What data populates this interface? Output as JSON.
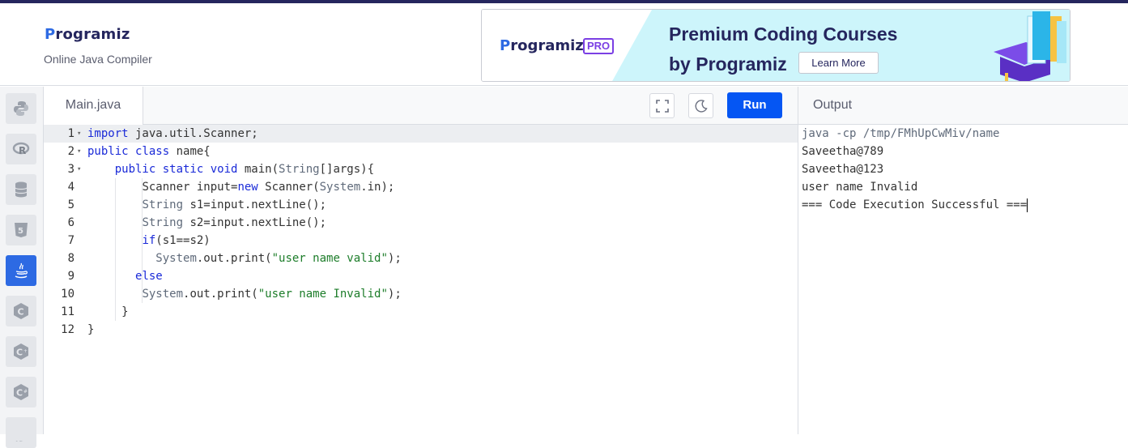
{
  "header": {
    "logo_text": "rogramiz",
    "logo_initial": "P",
    "subtitle": "Online Java Compiler"
  },
  "ad": {
    "logo_initial": "P",
    "logo_text": "rogramiz",
    "badge": "PRO",
    "headline_1": "Premium Coding Courses",
    "headline_2": "by Programiz",
    "button": "Learn More"
  },
  "sidebar": {
    "items": [
      {
        "name": "python-icon"
      },
      {
        "name": "r-icon"
      },
      {
        "name": "database-icon"
      },
      {
        "name": "html5-icon"
      },
      {
        "name": "java-icon",
        "active": true
      },
      {
        "name": "c-icon"
      },
      {
        "name": "cpp-icon"
      },
      {
        "name": "csharp-icon"
      },
      {
        "name": "js-icon"
      }
    ]
  },
  "editor": {
    "tab_label": "Main.java",
    "run_label": "Run",
    "lines": [
      {
        "n": "1",
        "fold": true
      },
      {
        "n": "2",
        "fold": true
      },
      {
        "n": "3",
        "fold": true
      },
      {
        "n": "4"
      },
      {
        "n": "5"
      },
      {
        "n": "6"
      },
      {
        "n": "7"
      },
      {
        "n": "8"
      },
      {
        "n": "9"
      },
      {
        "n": "10"
      },
      {
        "n": "11"
      },
      {
        "n": "12"
      }
    ],
    "code": {
      "l1a": "import",
      "l1b": " java.util.Scanner;",
      "l2a": "public class",
      "l2b": " name{",
      "l3a": "public static void",
      "l3b": " main(",
      "l3c": "String",
      "l3d": "[]args){",
      "l4a": "Scanner input=",
      "l4b": "new",
      "l4c": " Scanner(",
      "l4d": "System",
      "l4e": ".in);",
      "l5a": "String",
      "l5b": " s1=input.nextLine();",
      "l6a": "String",
      "l6b": " s2=input.nextLine();",
      "l7a": "if",
      "l7b": "(s1==s2)",
      "l8a": "System",
      "l8b": ".out.print(",
      "l8c": "\"user name valid\"",
      "l8d": ");",
      "l9a": "else",
      "l10a": "System",
      "l10b": ".out.print(",
      "l10c": "\"user name Invalid\"",
      "l10d": ");",
      "l11a": "}",
      "l12a": "}"
    }
  },
  "output": {
    "title": "Output",
    "lines": [
      "java -cp /tmp/FMhUpCwMiv/name",
      "Saveetha@789",
      "Saveetha@123",
      "user name Invalid",
      "=== Code Execution Successful ==="
    ]
  },
  "colors": {
    "accent": "#0556f3",
    "brand_dark": "#25265e",
    "keyword": "#1a2ad8",
    "string": "#1d7d2a"
  }
}
